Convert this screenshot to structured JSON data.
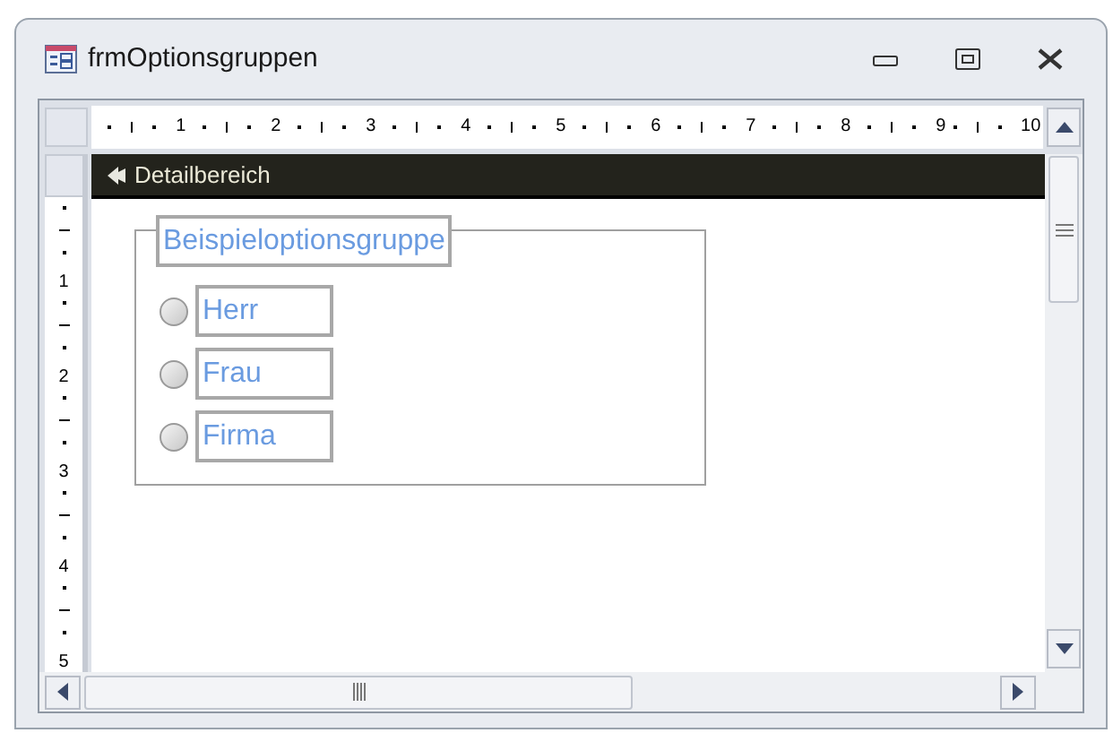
{
  "window": {
    "title": "frmOptionsgruppen"
  },
  "horizontal_ruler": {
    "labels": [
      "1",
      "2",
      "3",
      "4",
      "5",
      "6",
      "7",
      "8",
      "9",
      "10"
    ]
  },
  "vertical_ruler": {
    "labels": [
      "1",
      "2",
      "3",
      "4",
      "5"
    ]
  },
  "section": {
    "title": "Detailbereich"
  },
  "option_group": {
    "label": "Beispieloptionsgruppe",
    "options": [
      {
        "label": "Herr",
        "selected": false
      },
      {
        "label": "Frau",
        "selected": false
      },
      {
        "label": "Firma",
        "selected": false
      }
    ]
  }
}
